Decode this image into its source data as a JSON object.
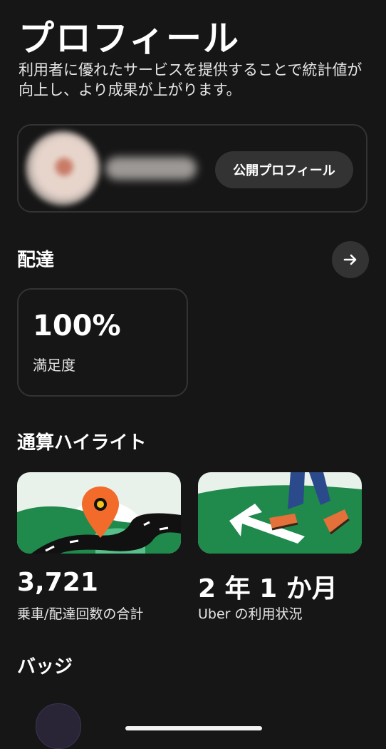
{
  "header": {
    "title": "プロフィール",
    "subtitle": "利用者に優れたサービスを提供することで統計値が向上し、より成果が上がります。"
  },
  "profile": {
    "public_profile_button": "公開プロフィール"
  },
  "delivery": {
    "section_title": "配達",
    "stat_value": "100%",
    "stat_label": "満足度"
  },
  "highlights": {
    "section_title": "通算ハイライト",
    "items": [
      {
        "value": "3,721",
        "label": "乗車/配達回数の合計"
      },
      {
        "value": "2 年 1 か月",
        "label": "Uber の利用状況"
      }
    ]
  },
  "badges": {
    "section_title": "バッジ"
  },
  "icons": [
    "arrow-right-icon",
    "map-pin-icon",
    "walking-arrow-icon"
  ],
  "colors": {
    "background": "#161616",
    "card_border": "#333333",
    "button_bg": "#333333",
    "brand_green": "#1f8a4c",
    "pin_orange": "#f26b2a"
  }
}
